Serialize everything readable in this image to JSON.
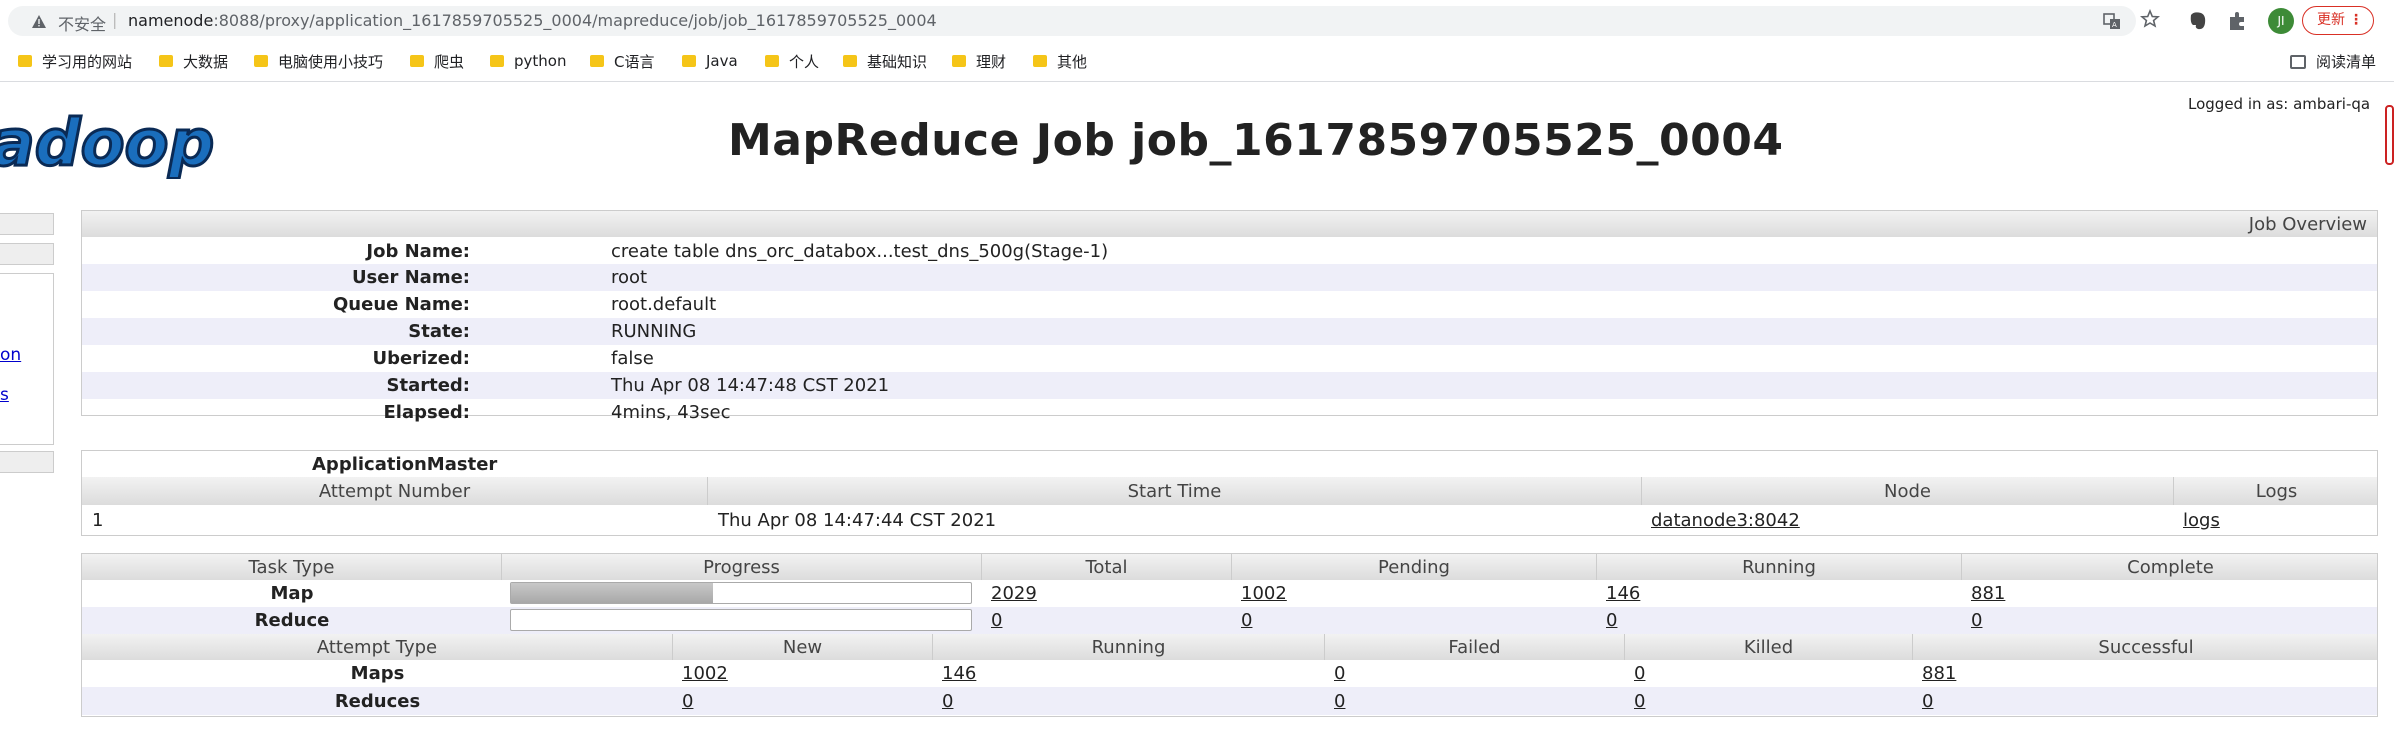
{
  "browser": {
    "security_label": "不安全",
    "url_host": "namenode",
    "url_rest": ":8088/proxy/application_1617859705525_0004/mapreduce/job/job_1617859705525_0004",
    "avatar_initials": "JI",
    "update_label": "更新",
    "bookmarks": [
      "学习用的网站",
      "大数据",
      "电脑使用小技巧",
      "爬虫",
      "python",
      "C语言",
      "Java",
      "个人",
      "基础知识",
      "理财",
      "其他"
    ],
    "reading_list_label": "阅读清单"
  },
  "header": {
    "logo_text": "hadoop",
    "logged_in": "Logged in as: ambari-qa",
    "page_title": "MapReduce Job job_1617859705525_0004"
  },
  "sidebar": {
    "link_partial_1": "on",
    "link_partial_2": "s"
  },
  "overview": {
    "title": "Job Overview",
    "rows": [
      {
        "label": "Job Name:",
        "value": "create table dns_orc_databox...test_dns_500g(Stage-1)"
      },
      {
        "label": "User Name:",
        "value": "root"
      },
      {
        "label": "Queue Name:",
        "value": "root.default"
      },
      {
        "label": "State:",
        "value": "RUNNING"
      },
      {
        "label": "Uberized:",
        "value": "false"
      },
      {
        "label": "Started:",
        "value": "Thu Apr 08 14:47:48 CST 2021"
      },
      {
        "label": "Elapsed:",
        "value": "4mins, 43sec"
      }
    ]
  },
  "app_master": {
    "title": "ApplicationMaster",
    "columns": [
      "Attempt Number",
      "Start Time",
      "Node",
      "Logs"
    ],
    "row": {
      "attempt": "1",
      "start": "Thu Apr 08 14:47:44 CST 2021",
      "node": "datanode3:8042",
      "logs": "logs"
    }
  },
  "tasks": {
    "columns": [
      "Task Type",
      "Progress",
      "Total",
      "Pending",
      "Running",
      "Complete"
    ],
    "rows": [
      {
        "type": "Map",
        "progress": 0.44,
        "total": "2029",
        "pending": "1002",
        "running": "146",
        "complete": "881"
      },
      {
        "type": "Reduce",
        "progress": 0.0,
        "total": "0",
        "pending": "0",
        "running": "0",
        "complete": "0"
      }
    ]
  },
  "attempts": {
    "columns": [
      "Attempt Type",
      "New",
      "Running",
      "Failed",
      "Killed",
      "Successful"
    ],
    "rows": [
      {
        "type": "Maps",
        "new": "1002",
        "running": "146",
        "failed": "0",
        "killed": "0",
        "successful": "881"
      },
      {
        "type": "Reduces",
        "new": "0",
        "running": "0",
        "failed": "0",
        "killed": "0",
        "successful": "0"
      }
    ]
  }
}
